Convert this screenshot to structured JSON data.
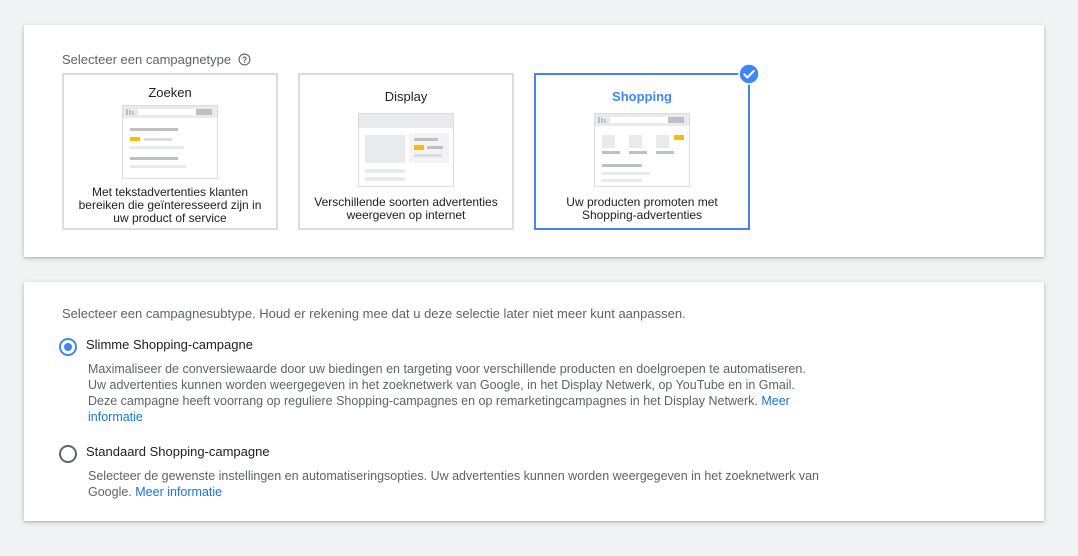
{
  "campaign_type": {
    "prompt": "Selecteer een campagnetype",
    "help_icon": "help-circle-icon",
    "options": [
      {
        "title": "Zoeken",
        "description": "Met tekstadvertenties klanten bereiken die geïnteresseerd zijn in uw product of service",
        "selected": false
      },
      {
        "title": "Display",
        "description": "Verschillende soorten advertenties weergeven op internet",
        "selected": false
      },
      {
        "title": "Shopping",
        "description": "Uw producten promoten met Shopping-advertenties",
        "selected": true
      }
    ],
    "selected_badge_icon": "check-circle-icon"
  },
  "campaign_subtype": {
    "prompt": "Selecteer een campagnesubtype. Houd er rekening mee dat u deze selectie later niet meer kunt aanpassen.",
    "options": [
      {
        "label": "Slimme Shopping-campagne",
        "selected": true,
        "description": "Maximaliseer de conversiewaarde door uw biedingen en targeting voor verschillende producten en doelgroepen te automatiseren. Uw advertenties kunnen worden weergegeven in het zoeknetwerk van Google, in het Display Netwerk, op YouTube en in Gmail. Deze campagne heeft voorrang op reguliere Shopping-campagnes en op remarketingcampagnes in het Display Netwerk.",
        "link": "Meer informatie"
      },
      {
        "label": "Standaard Shopping-campagne",
        "selected": false,
        "description": "Selecteer de gewenste instellingen en automatiseringsopties. Uw advertenties kunnen worden weergegeven in het zoeknetwerk van Google.",
        "link": "Meer informatie"
      }
    ]
  },
  "colors": {
    "accent": "#4285f4",
    "link": "#1a73e8",
    "ad_highlight": "#fbbc04",
    "border": "#dadce0"
  }
}
